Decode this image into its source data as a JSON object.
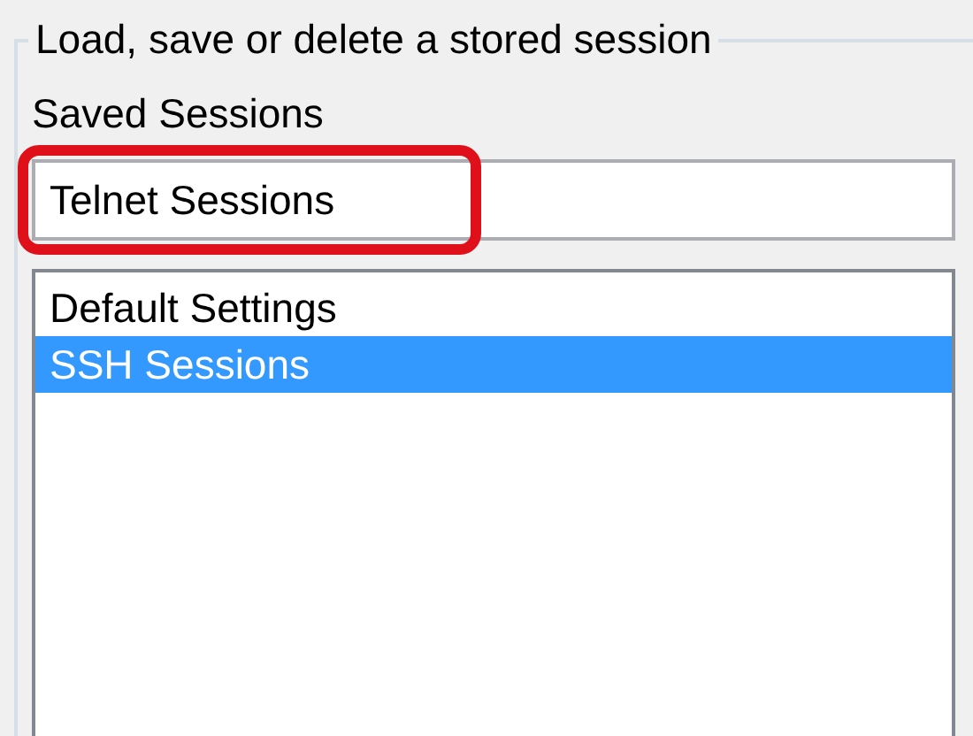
{
  "group": {
    "title": "Load, save or delete a stored session"
  },
  "saved_sessions": {
    "label": "Saved Sessions",
    "field": {
      "value": "Telnet Sessions",
      "highlighted": true
    },
    "items": [
      {
        "label": "Default Settings",
        "selected": false
      },
      {
        "label": "SSH Sessions",
        "selected": true
      }
    ]
  }
}
